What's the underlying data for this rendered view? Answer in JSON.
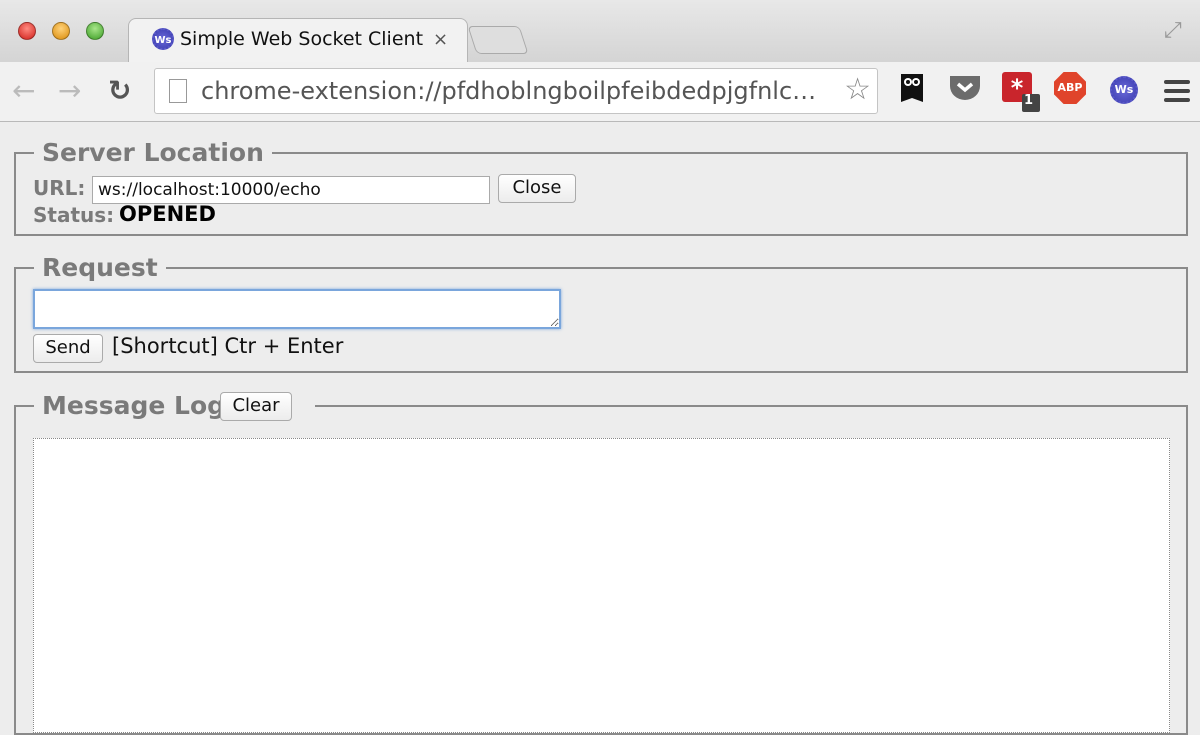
{
  "browser": {
    "tab_title": "Simple Web Socket Client",
    "tab_favicon": "Ws",
    "close_tab_glyph": "×",
    "address": "chrome-extension://pfdhoblngboilpfeibdedpjgfnlc…",
    "extensions": [
      {
        "name": "hootsuite-owl-icon"
      },
      {
        "name": "pocket-icon"
      },
      {
        "name": "lastpass-icon",
        "badge": "1"
      },
      {
        "name": "adblock-plus-icon",
        "label": "ABP"
      },
      {
        "name": "websocket-client-icon",
        "label": "Ws"
      }
    ]
  },
  "server": {
    "legend": "Server Location",
    "url_label": "URL:",
    "url_value": "ws://localhost:10000/echo",
    "close_label": "Close",
    "status_label": "Status:",
    "status_value": "OPENED"
  },
  "request": {
    "legend": "Request",
    "textarea_value": "",
    "send_label": "Send",
    "shortcut_text": "[Shortcut] Ctr + Enter"
  },
  "log": {
    "legend": "Message Log",
    "clear_label": "Clear",
    "messages": []
  }
}
